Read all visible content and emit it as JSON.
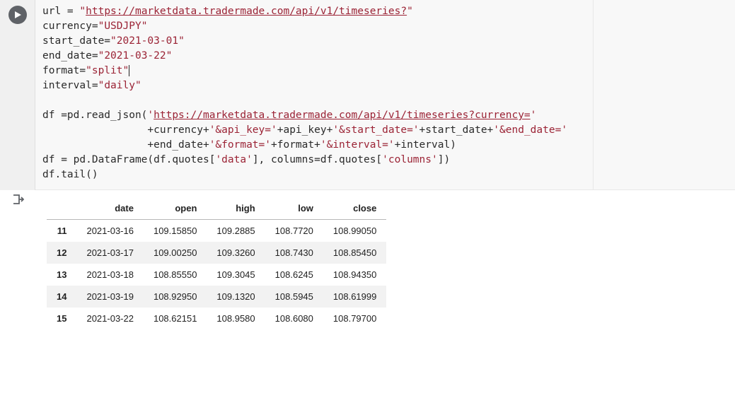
{
  "code": {
    "url": "https://marketdata.tradermade.com/api/v1/timeseries?",
    "currency": "USDJPY",
    "start_date": "2021-03-01",
    "end_date": "2021-03-22",
    "format": "split",
    "interval": "daily",
    "read_json_url_prefix": "https://marketdata.tradermade.com/api/v1/timeseries?currency=",
    "line_parts": {
      "l8_a": "df =pd.read_json(",
      "l8_b": "'",
      "l8_c": "'",
      "l9": "                 +currency+",
      "l9_s1": "'&api_key='",
      "l9_m1": "+api_key+",
      "l9_s2": "'&start_date='",
      "l9_m2": "+start_date+",
      "l9_s3": "'&end_date='",
      "l10": "                 +end_date+",
      "l10_s1": "'&format='",
      "l10_m1": "+format+",
      "l10_s2": "'&interval='",
      "l10_m2": "+interval)",
      "l11a": "df = pd.DataFrame(df.quotes[",
      "l11s1": "'data'",
      "l11b": "], columns=df.quotes[",
      "l11s2": "'columns'",
      "l11c": "])",
      "l12": "df.tail()"
    }
  },
  "chart_data": {
    "type": "table",
    "columns": [
      "date",
      "open",
      "high",
      "low",
      "close"
    ],
    "index": [
      "11",
      "12",
      "13",
      "14",
      "15"
    ],
    "rows": [
      [
        "2021-03-16",
        "109.15850",
        "109.2885",
        "108.7720",
        "108.99050"
      ],
      [
        "2021-03-17",
        "109.00250",
        "109.3260",
        "108.7430",
        "108.85450"
      ],
      [
        "2021-03-18",
        "108.85550",
        "109.3045",
        "108.6245",
        "108.94350"
      ],
      [
        "2021-03-19",
        "108.92950",
        "109.1320",
        "108.5945",
        "108.61999"
      ],
      [
        "2021-03-22",
        "108.62151",
        "108.9580",
        "108.6080",
        "108.79700"
      ]
    ]
  }
}
